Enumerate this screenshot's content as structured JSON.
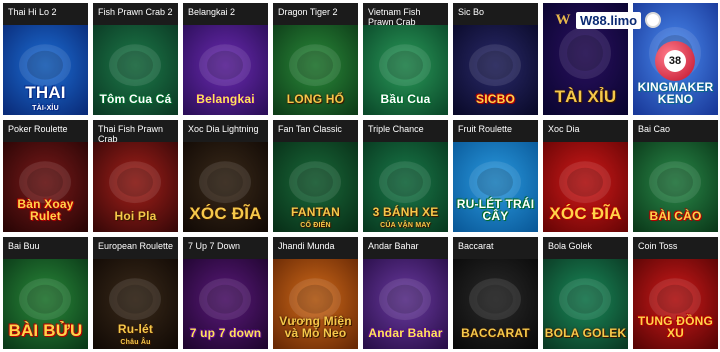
{
  "brand": {
    "mark": "W",
    "name": "W88.limo"
  },
  "games": [
    {
      "title": "Thai Hi Lo 2",
      "logo": "THAI",
      "logo_sub": "TÀI-XỈU",
      "colors": {
        "bg": "#1d6fd6",
        "bg2": "#0a2c7a"
      }
    },
    {
      "title": "Fish Prawn Crab 2",
      "logo": "Tôm Cua Cá",
      "colors": {
        "bg": "#1d7a4a",
        "bg2": "#0b3a24"
      }
    },
    {
      "title": "Belangkai 2",
      "logo": "Belangkai",
      "colors": {
        "bg": "#6a2ab0",
        "bg2": "#2c0f5a"
      }
    },
    {
      "title": "Dragon Tiger 2",
      "logo": "LONG HỔ",
      "colors": {
        "bg": "#2a8a3a",
        "bg2": "#0e3d18"
      }
    },
    {
      "title": "Vietnam Fish Prawn Crab",
      "logo": "Bầu Cua",
      "colors": {
        "bg": "#2a9a5a",
        "bg2": "#0b4a2a"
      }
    },
    {
      "title": "Sic Bo",
      "logo": "SICBO",
      "colors": {
        "bg": "#2a2a6a",
        "bg2": "#0a0a2a"
      }
    },
    {
      "title": "",
      "logo": "TÀI XỈU",
      "colors": {
        "bg": "#2a1060",
        "bg2": "#0a0530"
      }
    },
    {
      "title": "",
      "logo": "KINGMAKER KENO",
      "ball_number": "38",
      "colors": {
        "bg": "#4a8af0",
        "bg2": "#1a3a9a"
      }
    },
    {
      "title": "Poker Roulette",
      "logo": "Bàn Xoay Rulet",
      "colors": {
        "bg": "#7a1a1a",
        "bg2": "#2a0505"
      }
    },
    {
      "title": "Thai Fish Prawn Crab",
      "logo": "Hoi Pla",
      "colors": {
        "bg": "#a3201a",
        "bg2": "#3a0808"
      }
    },
    {
      "title": "Xoc Dia Lightning",
      "logo": "XÓC ĐĨA",
      "colors": {
        "bg": "#3a2a1a",
        "bg2": "#120a05"
      }
    },
    {
      "title": "Fan Tan Classic",
      "logo": "FANTAN",
      "logo_sub": "CỔ ĐIỂN",
      "colors": {
        "bg": "#1a6a3a",
        "bg2": "#083018"
      }
    },
    {
      "title": "Triple Chance",
      "logo": "3 BÁNH XE",
      "logo_sub": "CỦA VẬN MAY",
      "colors": {
        "bg": "#1a7a4a",
        "bg2": "#083a20"
      }
    },
    {
      "title": "Fruit Roulette",
      "logo": "RU-LÉT TRÁI CÂY",
      "colors": {
        "bg": "#2a9ae0",
        "bg2": "#0a5a9a"
      }
    },
    {
      "title": "Xoc Dia",
      "logo": "XÓC ĐĨA",
      "colors": {
        "bg": "#d01a1a",
        "bg2": "#6a0505"
      }
    },
    {
      "title": "Bai Cao",
      "logo": "BÀI CÀO",
      "colors": {
        "bg": "#2a8a4a",
        "bg2": "#0b3a1a"
      }
    },
    {
      "title": "Bai Buu",
      "logo": "BÀI BỬU",
      "colors": {
        "bg": "#2a8a3a",
        "bg2": "#0b3a18"
      }
    },
    {
      "title": "European Roulette",
      "logo": "Ru-lét",
      "logo_sub": "Châu Âu",
      "colors": {
        "bg": "#3a2a1a",
        "bg2": "#120a05"
      }
    },
    {
      "title": "7 Up 7 Down",
      "logo": "7 up 7 down",
      "colors": {
        "bg": "#5a1a7a",
        "bg2": "#200530"
      }
    },
    {
      "title": "Jhandi Munda",
      "logo": "Vương Miện và Mỏ Neo",
      "colors": {
        "bg": "#d06a1a",
        "bg2": "#6a2a05"
      }
    },
    {
      "title": "Andar Bahar",
      "logo": "Andar Bahar",
      "colors": {
        "bg": "#6a3aa0",
        "bg2": "#2a0f4a"
      }
    },
    {
      "title": "Baccarat",
      "logo": "BACCARAT",
      "colors": {
        "bg": "#2a2a2a",
        "bg2": "#0a0a0a"
      }
    },
    {
      "title": "Bola Golek",
      "logo": "BOLA GOLEK",
      "colors": {
        "bg": "#1a8a5a",
        "bg2": "#0b3a24"
      }
    },
    {
      "title": "Coin Toss",
      "logo": "TUNG ĐỒNG XU",
      "colors": {
        "bg": "#d01a1a",
        "bg2": "#5a0505"
      }
    }
  ]
}
